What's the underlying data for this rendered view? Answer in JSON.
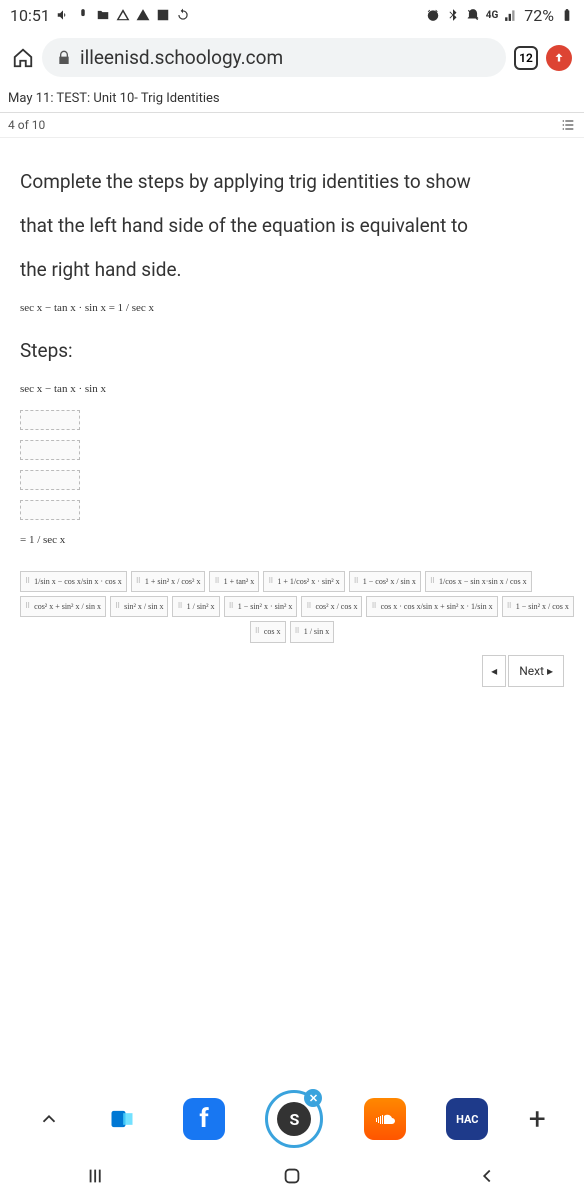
{
  "status": {
    "time": "10:51",
    "battery": "72%"
  },
  "browser": {
    "url": "illeenisd.schoology.com",
    "tabs": "12"
  },
  "crumb": "May 11: TEST: Unit 10- Trig Identities",
  "progress": "4 of 10",
  "content": {
    "p1": "Complete the steps by applying trig identities to show",
    "p2": "that the left hand side of the equation is equivalent to",
    "p3": "the right hand side.",
    "eq1": "sec x − tan x · sin x = 1 / sec x",
    "steps_label": "Steps:",
    "eq2": "sec x − tan x · sin x",
    "eq_final": "= 1 / sec x"
  },
  "tiles_row1": [
    "1/sin x − cos x/sin x · cos x",
    "1 + sin² x / cos² x",
    "1 + tan² x",
    "1 + 1/cos² x · sin² x",
    "1 − cos² x / sin x",
    "1/cos x − sin x·sin x / cos x"
  ],
  "tiles_row2": [
    "cos² x + sin² x / sin x",
    "sin² x / sin x",
    "1 / sin² x",
    "1 − sin² x · sin² x",
    "cos² x / cos x",
    "cos x · cos x/sin x + sin² x · 1/sin x",
    "1 − sin² x / cos x"
  ],
  "tiles_row3": [
    "cos x",
    "1 / sin x"
  ],
  "nav": {
    "prev": "◂",
    "next": "Next ▸"
  },
  "dock": {
    "hac": "HAC"
  }
}
